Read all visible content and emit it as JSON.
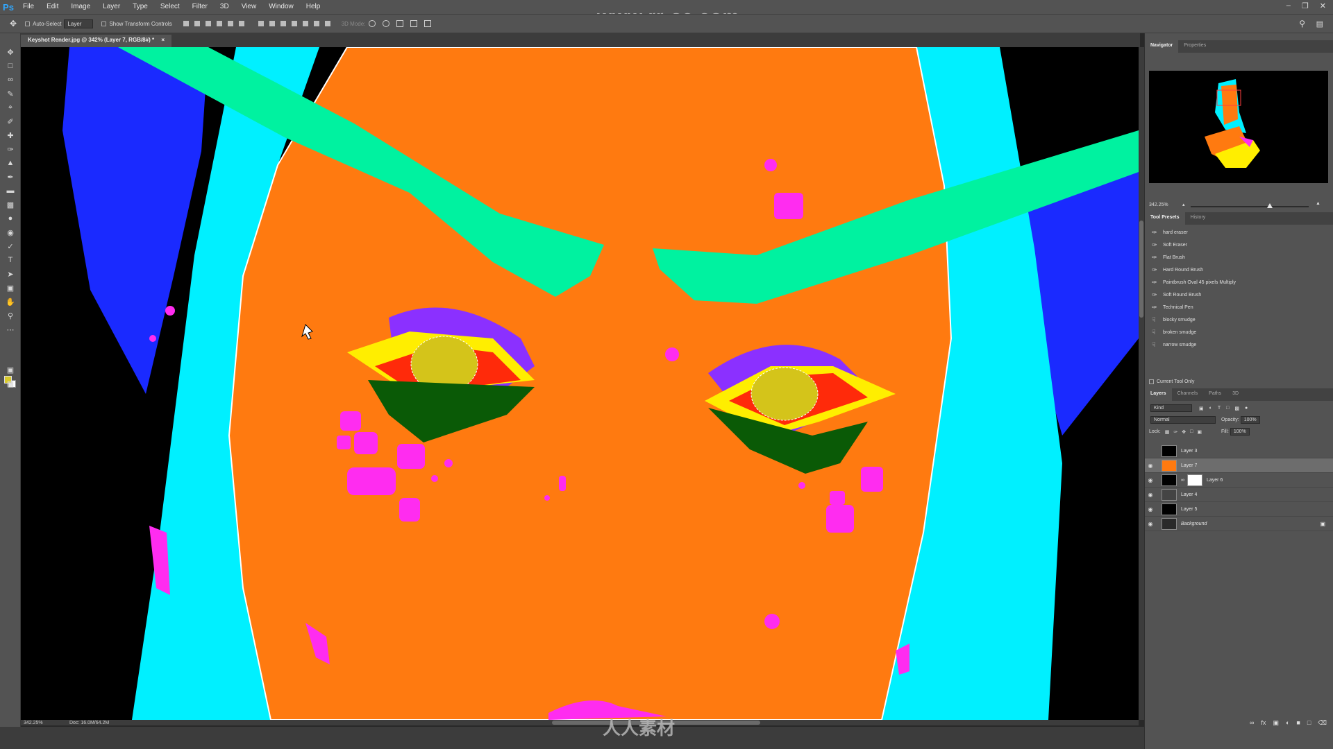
{
  "app": {
    "logo": "Ps",
    "watermark": "www.rr-sc.com",
    "bottom_watermark": "人人素材"
  },
  "menu": [
    "File",
    "Edit",
    "Image",
    "Layer",
    "Type",
    "Select",
    "Filter",
    "3D",
    "View",
    "Window",
    "Help"
  ],
  "options": {
    "auto_select_label": "Auto-Select",
    "auto_select_value": "Layer",
    "transform_label": "Show Transform Controls",
    "mode_3d": "3D Mode:"
  },
  "document": {
    "tab_title": "Keyshot Render.jpg @ 342% (Layer 7, RGB/8#) *",
    "tab_close": "×"
  },
  "status": {
    "zoom": "342.25%",
    "doc": "Doc: 16.0M/64.2M"
  },
  "colors": {
    "foreground": "#d8c92a",
    "background": "#ffffff",
    "face": "#ff7a10",
    "hair": "#00f0ff",
    "brows": "#00f2a0",
    "spots": "#ff2cf0",
    "accent": "#31a8ff"
  },
  "navigator": {
    "tabs": [
      "Navigator",
      "Properties"
    ],
    "zoom": "342.25%"
  },
  "tool_presets": {
    "tabs": [
      "Tool Presets",
      "History"
    ],
    "items": [
      "hard eraser",
      "Soft Eraser",
      "Flat Brush",
      "Hard Round Brush",
      "Paintbrush Oval 45 pixels Multiply",
      "Soft Round Brush",
      "Technical Pen",
      "blocky smudge",
      "broken smudge",
      "narrow smudge"
    ],
    "current_tool_only": "Current Tool Only"
  },
  "layers": {
    "tabs": [
      "Layers",
      "Channels",
      "Paths",
      "3D"
    ],
    "kind": "Kind",
    "blend": "Normal",
    "opacity_label": "Opacity:",
    "opacity": "100%",
    "lock_label": "Lock:",
    "fill_label": "Fill:",
    "fill": "100%",
    "items": [
      {
        "name": "Layer 3",
        "visible": false
      },
      {
        "name": "Layer 7",
        "visible": true,
        "selected": true
      },
      {
        "name": "Layer 6",
        "visible": true,
        "mask": true
      },
      {
        "name": "Layer 4",
        "visible": true
      },
      {
        "name": "Layer 5",
        "visible": true
      },
      {
        "name": "Background",
        "visible": true,
        "locked": true
      }
    ]
  }
}
